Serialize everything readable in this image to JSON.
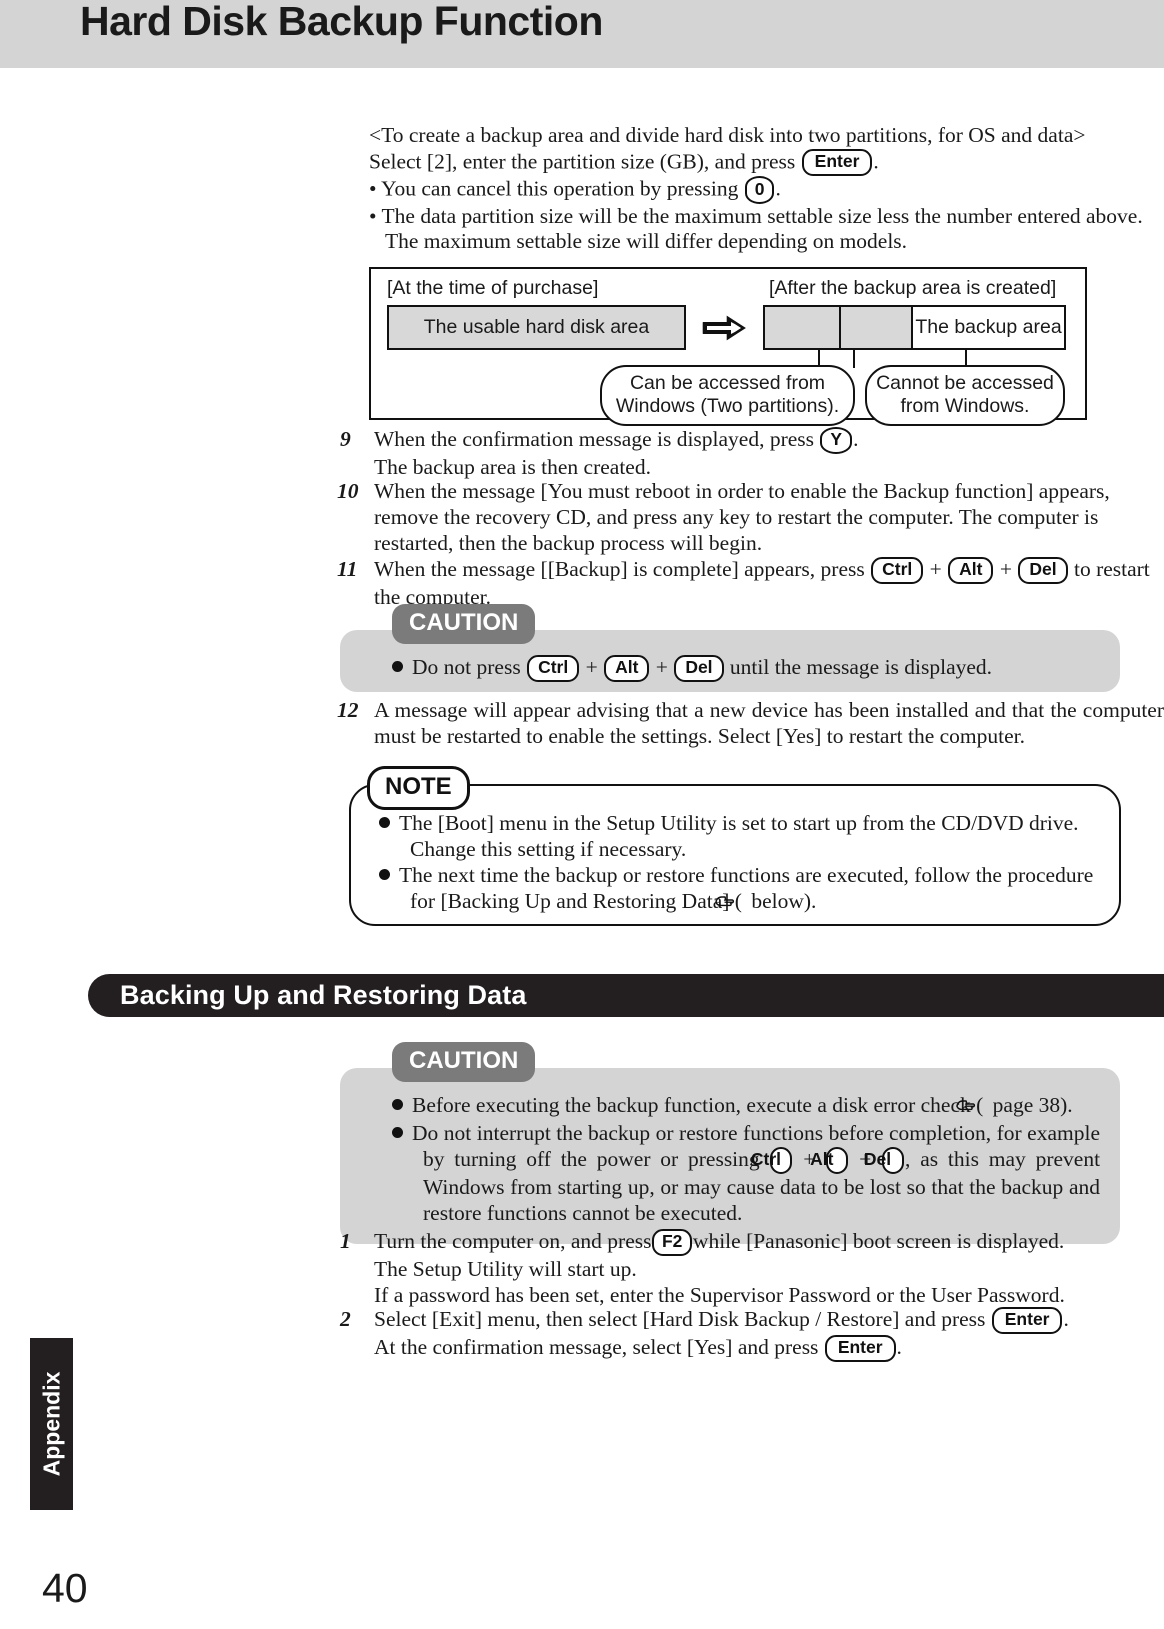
{
  "header": {
    "title": "Hard Disk Backup Function"
  },
  "intro": {
    "line1": "<To create a backup area and divide hard disk into two partitions, for OS and data>",
    "line2_a": "Select [2], enter the partition size (GB), and press",
    "line2_key": "Enter",
    "line2_b": ".",
    "bullet1_a": "• You can cancel this operation by pressing",
    "bullet1_key": "0",
    "bullet1_b": ".",
    "bullet2_line1": "• The data partition size will be the maximum settable size less the number entered above.",
    "bullet2_line2": "The maximum settable size will differ depending on models."
  },
  "diagram": {
    "label_left": "[At the time of purchase]",
    "label_right": "[After the backup area is created]",
    "bar_left_text": "The usable hard disk area",
    "bar_right_backup_text": "The backup area",
    "arrow": "double-right-arrow-icon",
    "callout_left": "Can be accessed from Windows (Two partitions).",
    "callout_left_line1": "Can be accessed from",
    "callout_left_line2": "Windows (Two partitions).",
    "callout_right_line1": "Cannot be accessed",
    "callout_right_line2": "from Windows."
  },
  "steps_upper": [
    {
      "num": "9",
      "parts": [
        "When the confirmation message is displayed, press",
        "KEY:Y",
        "."
      ],
      "line2": "The backup area is then created."
    },
    {
      "num": "10",
      "text": "When the message [You must reboot in order to enable the Backup function] appears, remove the recovery CD, and press any key to restart the computer. The computer is restarted, then the backup process will begin."
    },
    {
      "num": "11",
      "prefix": "When the message [[Backup] is complete] appears, press",
      "keys": [
        "Ctrl",
        "Alt",
        "Del"
      ],
      "suffix": "to restart",
      "line2": "the computer."
    }
  ],
  "caution1": {
    "label": "CAUTION",
    "bullet_prefix": "Do not press",
    "keys": [
      "Ctrl",
      "Alt",
      "Del"
    ],
    "bullet_suffix": "until the message is displayed."
  },
  "step12": {
    "num": "12",
    "text": "A message will appear advising that a new device has been installed and that the computer must be restarted to enable the settings.  Select [Yes] to restart the computer."
  },
  "note": {
    "label": "NOTE",
    "bullets": [
      "The [Boot] menu in the Setup Utility is set to start up from the CD/DVD drive. Change this setting if necessary.",
      "The next time the backup or restore functions are executed, follow the procedure for [Backing Up and Restoring Data] ("
    ],
    "bullet2_icon": "pointing-hand-icon",
    "bullet2_tail": " below)."
  },
  "section": {
    "title": "Backing Up and Restoring Data"
  },
  "caution2": {
    "label": "CAUTION",
    "bullet1_prefix": "Before executing the backup function, execute a disk error check (",
    "bullet1_icon": "pointing-hand-icon",
    "bullet1_suffix": " page 38).",
    "bullet2_part1": "Do not interrupt the backup or restore functions before completion, for example by turning off the power or pressing",
    "bullet2_keys": [
      "Ctrl",
      "Alt",
      "Del"
    ],
    "bullet2_part2": ", as this may prevent Windows from starting up, or may cause data to be lost so that the backup and restore functions cannot be executed."
  },
  "steps_lower": [
    {
      "num": "1",
      "prefix": "Turn the computer on, and press",
      "key": "F2",
      "suffix": "while [Panasonic] boot screen is displayed.",
      "line2": "The Setup Utility will start up.",
      "line3": "If a password has been set, enter the Supervisor Password or the User Password."
    },
    {
      "num": "2",
      "prefix": "Select [Exit] menu, then select [Hard Disk Backup / Restore] and press",
      "key": "Enter",
      "suffix": ".",
      "line2_prefix": "At the confirmation message, select [Yes] and press",
      "line2_key": "Enter",
      "line2_suffix": "."
    }
  ],
  "footer": {
    "side_tab": "Appendix",
    "page_number": "40"
  },
  "colors": {
    "header_bg": "#d4d4d4",
    "caution_tab": "#7b7b7b",
    "caution_body": "#d4d4d4",
    "section_bar": "#231f20",
    "diagram_fill": "#d8d8d8"
  }
}
